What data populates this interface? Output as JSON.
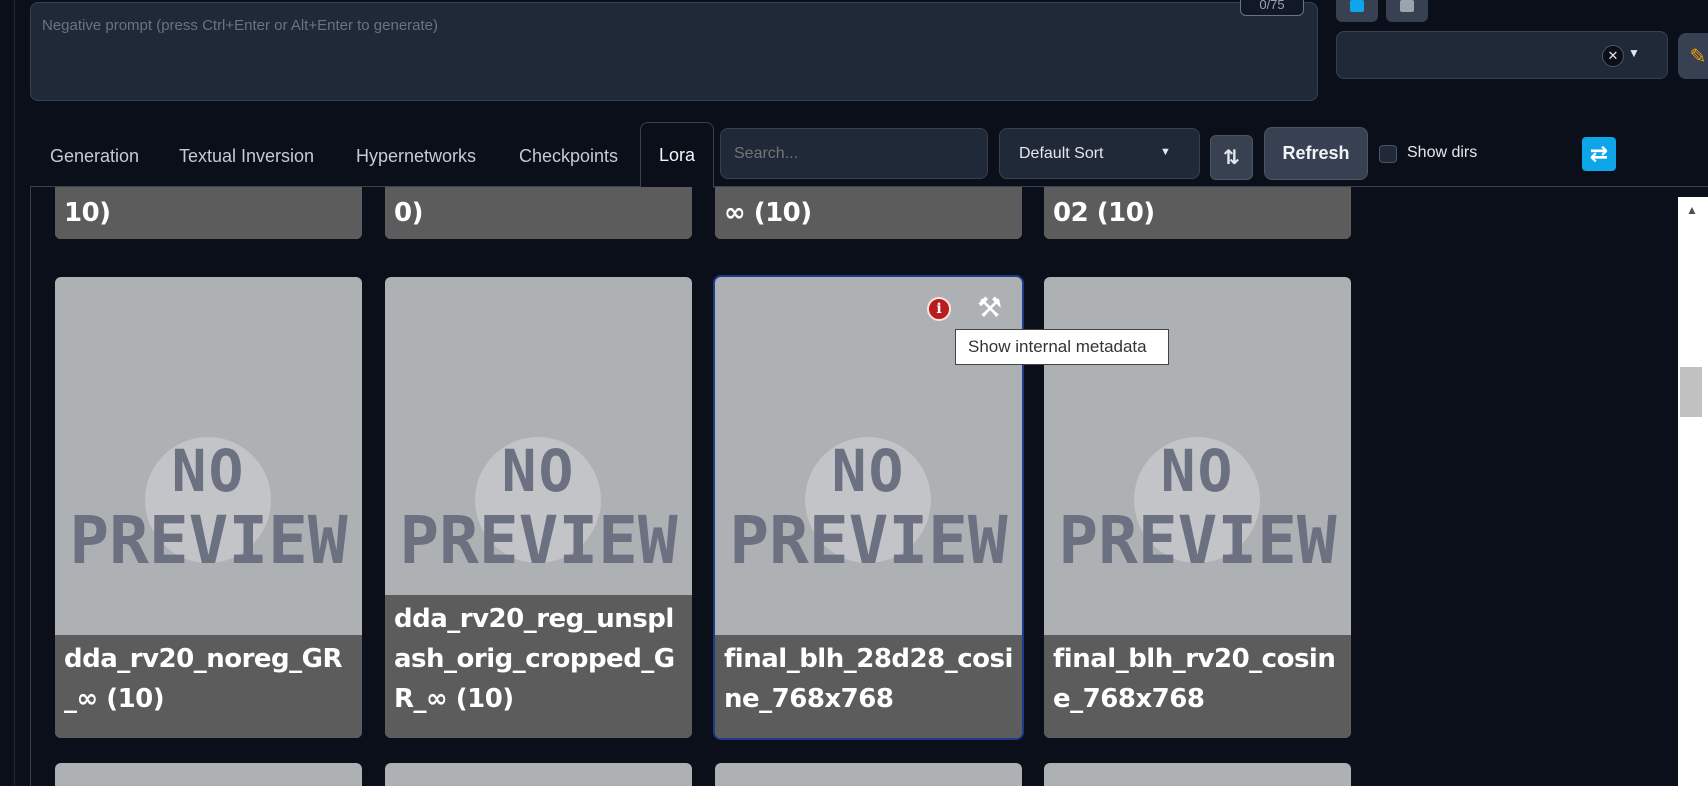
{
  "negative_prompt": {
    "placeholder": "Negative prompt (press Ctrl+Enter or Alt+Enter to generate)",
    "token_counter": "0/75"
  },
  "style_select": {
    "value": "",
    "clear_icon": "close-icon",
    "caret_icon": "chevron-down-icon"
  },
  "tabs": [
    {
      "label": "Generation"
    },
    {
      "label": "Textual Inversion"
    },
    {
      "label": "Hypernetworks"
    },
    {
      "label": "Checkpoints"
    },
    {
      "label": "Lora"
    }
  ],
  "active_tab": "Lora",
  "search": {
    "placeholder": "Search..."
  },
  "sort": {
    "value": "Default Sort"
  },
  "refresh_label": "Refresh",
  "show_dirs": {
    "label": "Show dirs",
    "checked": false
  },
  "top_row_cards": [
    {
      "label": "10)"
    },
    {
      "label": "0)"
    },
    {
      "label": "∞ (10)"
    },
    {
      "label": "02 (10)"
    }
  ],
  "cards": [
    {
      "label": "dda_rv20_noreg_GR_∞ (10)",
      "preview_line1": "NO",
      "preview_line2": "PREVIEW"
    },
    {
      "label": "dda_rv20_reg_unsplash_orig_cropped_GR_∞ (10)",
      "preview_line1": "NO",
      "preview_line2": "PREVIEW"
    },
    {
      "label": "final_blh_28d28_cosine_768x768",
      "preview_line1": "NO",
      "preview_line2": "PREVIEW",
      "selected": true
    },
    {
      "label": "final_blh_rv20_cosine_768x768",
      "preview_line1": "NO",
      "preview_line2": "PREVIEW"
    }
  ],
  "tooltip": "Show internal metadata",
  "colors": {
    "accent_blue": "#0ea5e9",
    "info_red": "#b91c1c",
    "card_bg": "#aeb1b4",
    "page_bg": "#0b0f19"
  }
}
